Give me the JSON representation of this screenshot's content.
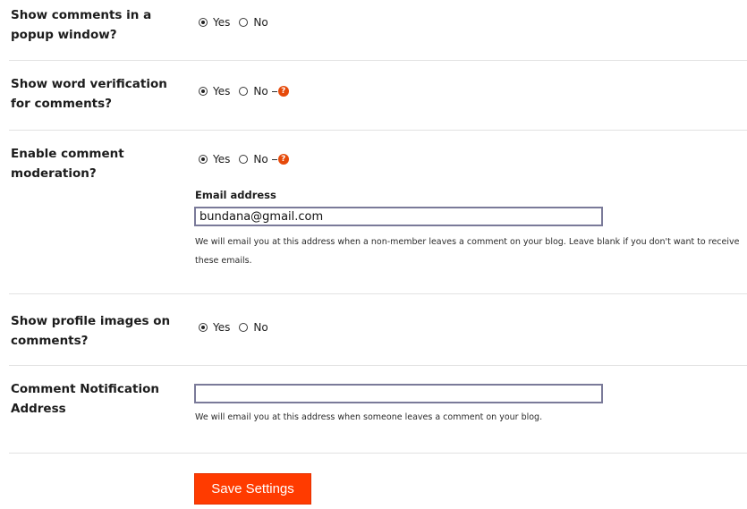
{
  "settings": [
    {
      "label": "Show comments in a popup window?",
      "yes_label": "Yes",
      "no_label": "No",
      "selected": "yes",
      "help": false
    },
    {
      "label": "Show word verification for comments?",
      "yes_label": "Yes",
      "no_label": "No",
      "selected": "yes",
      "help": true
    },
    {
      "label": "Enable comment moderation?",
      "yes_label": "Yes",
      "no_label": "No",
      "selected": "yes",
      "help": true
    },
    {
      "label": "Show profile images on comments?",
      "yes_label": "Yes",
      "no_label": "No",
      "selected": "yes",
      "help": false
    }
  ],
  "moderation_email": {
    "label": "Email address",
    "value": "bundana@gmail.com",
    "hint": "We will email you at this address when a non-member leaves a comment on your blog. Leave blank if you don't want to receive these emails."
  },
  "notification": {
    "label": "Comment Notification Address",
    "value": "",
    "hint": "We will email you at this address when someone leaves a comment on your blog."
  },
  "save_label": "Save Settings",
  "help_glyph": "?",
  "colors": {
    "accent": "#ff3b00",
    "help": "#e64a0a"
  }
}
